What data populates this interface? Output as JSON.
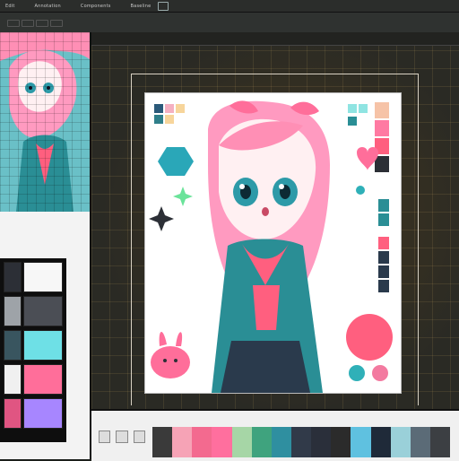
{
  "menu": {
    "items": [
      "Edit",
      "Annotation",
      "Components",
      "Baseline"
    ],
    "colors": {
      "menubar": "#2b2d2b",
      "toolbar": "#2f3230"
    }
  },
  "left_panel": {
    "preview_colors": {
      "pink": "#ff8fb5",
      "teal": "#3fb6c3",
      "skin": "#fff0f2"
    },
    "swatches": [
      {
        "color": "#2c2f36"
      },
      {
        "color": "#f7f7f7"
      },
      {
        "color": "#9ea3a8"
      },
      {
        "color": "#4b4e55"
      },
      {
        "color": "#39555f"
      },
      {
        "color": "#6ee0e6"
      },
      {
        "color": "#f0f0f0"
      },
      {
        "color": "#ff6e9a"
      },
      {
        "color": "#e05582"
      },
      {
        "color": "#a786ff"
      }
    ]
  },
  "artboard": {
    "palette_left": [
      "#2b5a7a",
      "#f5b0c1",
      "#2f7f8a",
      "#f7d59b"
    ],
    "palette_right": [
      "#8fe4e2",
      "#f6c3a7",
      "#ff7aa2",
      "#2c2f36",
      "#2a8e95",
      "#ff5f7f",
      "#2a3a4c",
      "#f7b3c6"
    ],
    "shapes": {
      "hexagon": "#2aa7b8",
      "heart": "#ff6e9a",
      "circle": "#ff5f7f",
      "circle_small_1": "#2fb0b8",
      "circle_small_2": "#f37aa0"
    }
  },
  "bottom_strip": [
    "#3a3a3a",
    "#f6a3b6",
    "#f36a8f",
    "#ff6f9e",
    "#a6d6a6",
    "#3fa37e",
    "#2f8fa0",
    "#313a49",
    "#2a2f3a",
    "#2b2b2b",
    "#5fc1e0",
    "#1f2a39",
    "#9ad0d9",
    "#5b6b77",
    "#3c3f43"
  ]
}
